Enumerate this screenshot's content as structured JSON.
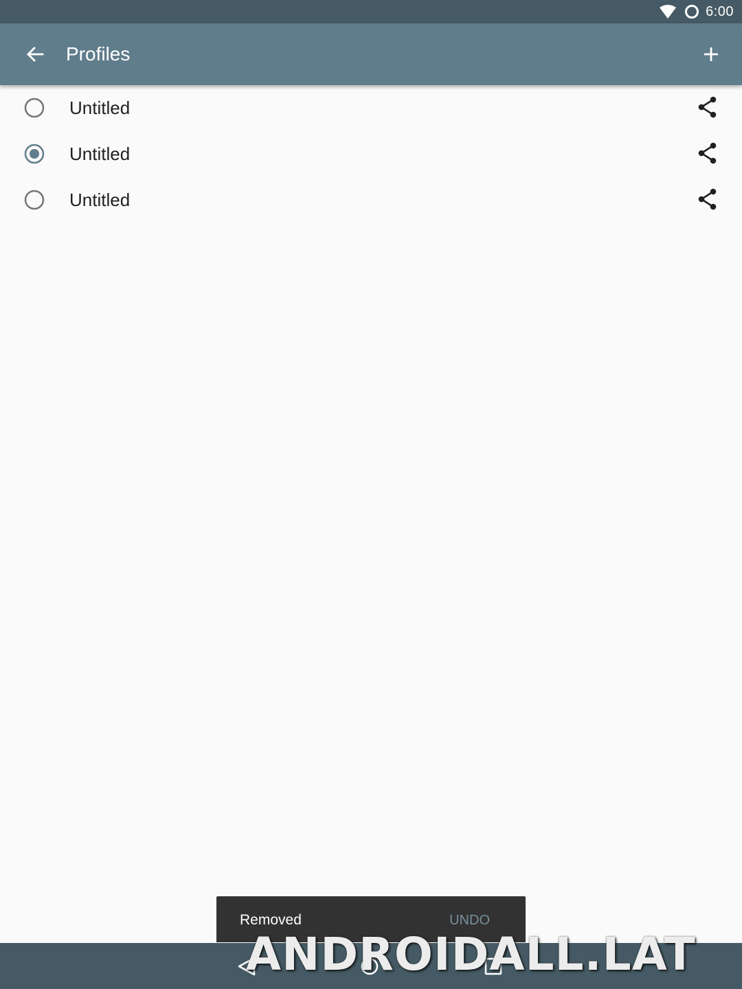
{
  "status_bar": {
    "time": "6:00",
    "icons": [
      "wifi-icon",
      "sync-icon"
    ]
  },
  "app_bar": {
    "title": "Profiles",
    "back_icon": "arrow-back-icon",
    "add_icon": "plus-icon",
    "color": "#607d8b"
  },
  "profiles": [
    {
      "label": "Untitled",
      "selected": false
    },
    {
      "label": "Untitled",
      "selected": true
    },
    {
      "label": "Untitled",
      "selected": false
    }
  ],
  "snackbar": {
    "message": "Removed",
    "action": "UNDO"
  },
  "nav_bar": {
    "icons": [
      "nav-back-icon",
      "nav-home-icon",
      "nav-recents-icon"
    ]
  },
  "watermark": {
    "text": "ANDROIDALL.LAT"
  },
  "colors": {
    "status_bar": "#455a64",
    "accent": "#607d8b",
    "background": "#fafafa"
  }
}
